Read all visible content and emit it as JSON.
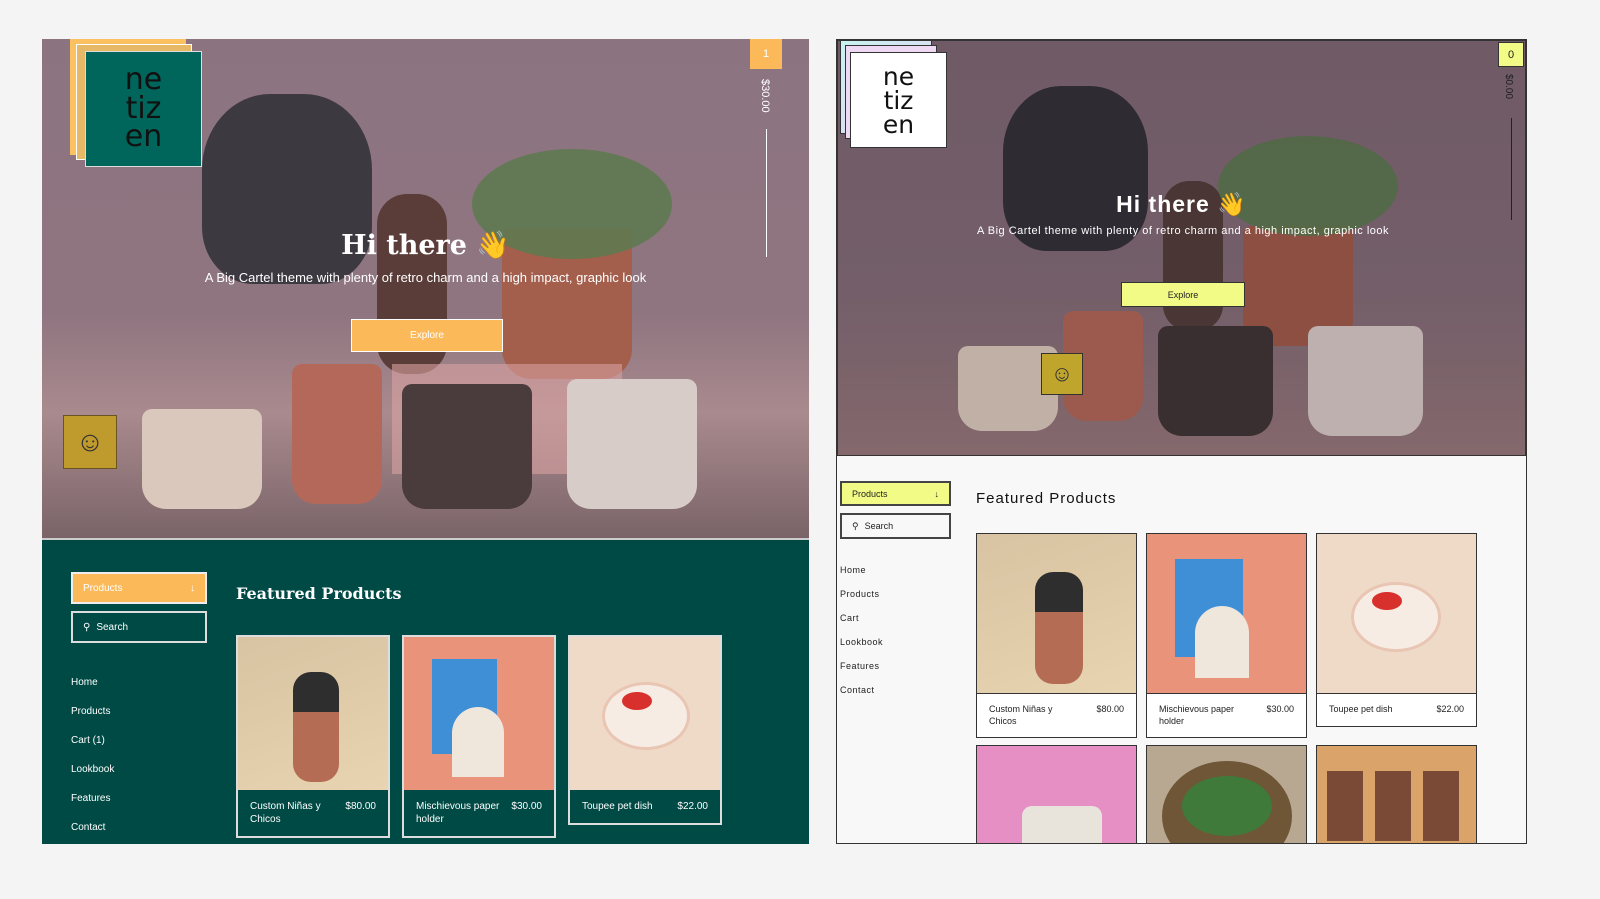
{
  "left": {
    "logo": [
      "ne",
      "tiz",
      "en"
    ],
    "cart_count": "1",
    "cart_total": "$30.00",
    "hero_title": "Hi there 👋",
    "hero_subtitle": "A Big Cartel theme with plenty of retro charm and a high impact, graphic look",
    "explore_label": "Explore",
    "products_dropdown": "Products",
    "search_placeholder": "Search",
    "nav": [
      "Home",
      "Products",
      "Cart (1)",
      "Lookbook",
      "Features",
      "Contact"
    ],
    "featured_title": "Featured Products",
    "products": [
      {
        "name": "Custom Niñas y Chicos",
        "price": "$80.00"
      },
      {
        "name": "Mischievous paper holder",
        "price": "$30.00"
      },
      {
        "name": "Toupee pet dish",
        "price": "$22.00"
      }
    ],
    "colors": {
      "background": "#004a45",
      "accent": "#fbb95a"
    }
  },
  "right": {
    "logo": [
      "ne",
      "tiz",
      "en"
    ],
    "cart_count": "0",
    "cart_total": "$0.00",
    "hero_title": "Hi there 👋",
    "hero_subtitle": "A Big Cartel theme with plenty of retro charm and a high impact, graphic look",
    "explore_label": "Explore",
    "products_dropdown": "Products",
    "search_placeholder": "Search",
    "nav": [
      "Home",
      "Products",
      "Cart",
      "Lookbook",
      "Features",
      "Contact"
    ],
    "featured_title": "Featured Products",
    "products": [
      {
        "name": "Custom Niñas y Chicos",
        "price": "$80.00"
      },
      {
        "name": "Mischievous paper holder",
        "price": "$30.00"
      },
      {
        "name": "Toupee pet dish",
        "price": "$22.00"
      }
    ],
    "colors": {
      "background": "#f8f8f8",
      "accent": "#f2fb86"
    }
  }
}
